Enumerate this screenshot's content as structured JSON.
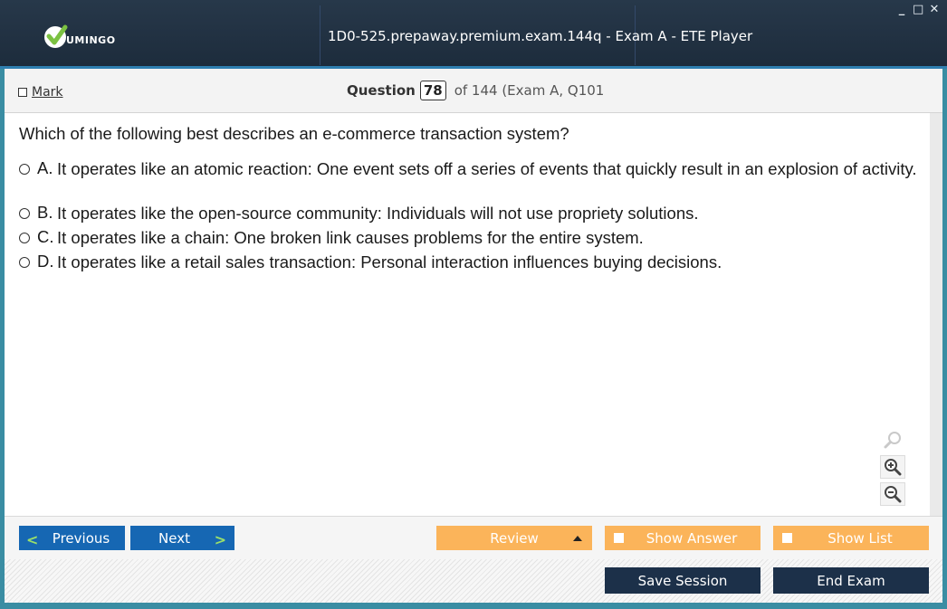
{
  "window": {
    "title": "1D0-525.prepaway.premium.exam.144q - Exam A - ETE Player",
    "logo_text": "UMINGO",
    "controls": {
      "minimize": "_",
      "maximize": "□",
      "close": "✕"
    }
  },
  "header": {
    "mark_label": "Mark",
    "question_label": "Question",
    "question_number": "78",
    "question_of": "of 144 (Exam A, Q101"
  },
  "question": {
    "text": "Which of the following best describes an e-commerce transaction system?",
    "options": [
      {
        "letter": "A.",
        "text": "It operates like an atomic reaction: One event sets off a series of events that quickly result in an explosion of activity."
      },
      {
        "letter": "B.",
        "text": "It operates like the open-source community: Individuals will not use propriety solutions."
      },
      {
        "letter": "C.",
        "text": "It operates like a chain: One broken link causes problems for the entire system."
      },
      {
        "letter": "D.",
        "text": "It operates like a retail sales transaction: Personal interaction influences buying decisions."
      }
    ]
  },
  "navigation": {
    "previous_label": "Previous",
    "next_label": "Next",
    "review_label": "Review",
    "show_answer_label": "Show Answer",
    "show_list_label": "Show List",
    "save_session_label": "Save Session",
    "end_exam_label": "End Exam"
  },
  "zoom_tools": [
    "search-icon",
    "zoom-in-icon",
    "zoom-out-icon"
  ],
  "colors": {
    "titlebar": "#1d2c3c",
    "frame": "#3a8da3",
    "nav_blue": "#1667b3",
    "nav_orange": "#fbb45a",
    "action_dark": "#1c3049",
    "logo_green": "#7cc242"
  }
}
